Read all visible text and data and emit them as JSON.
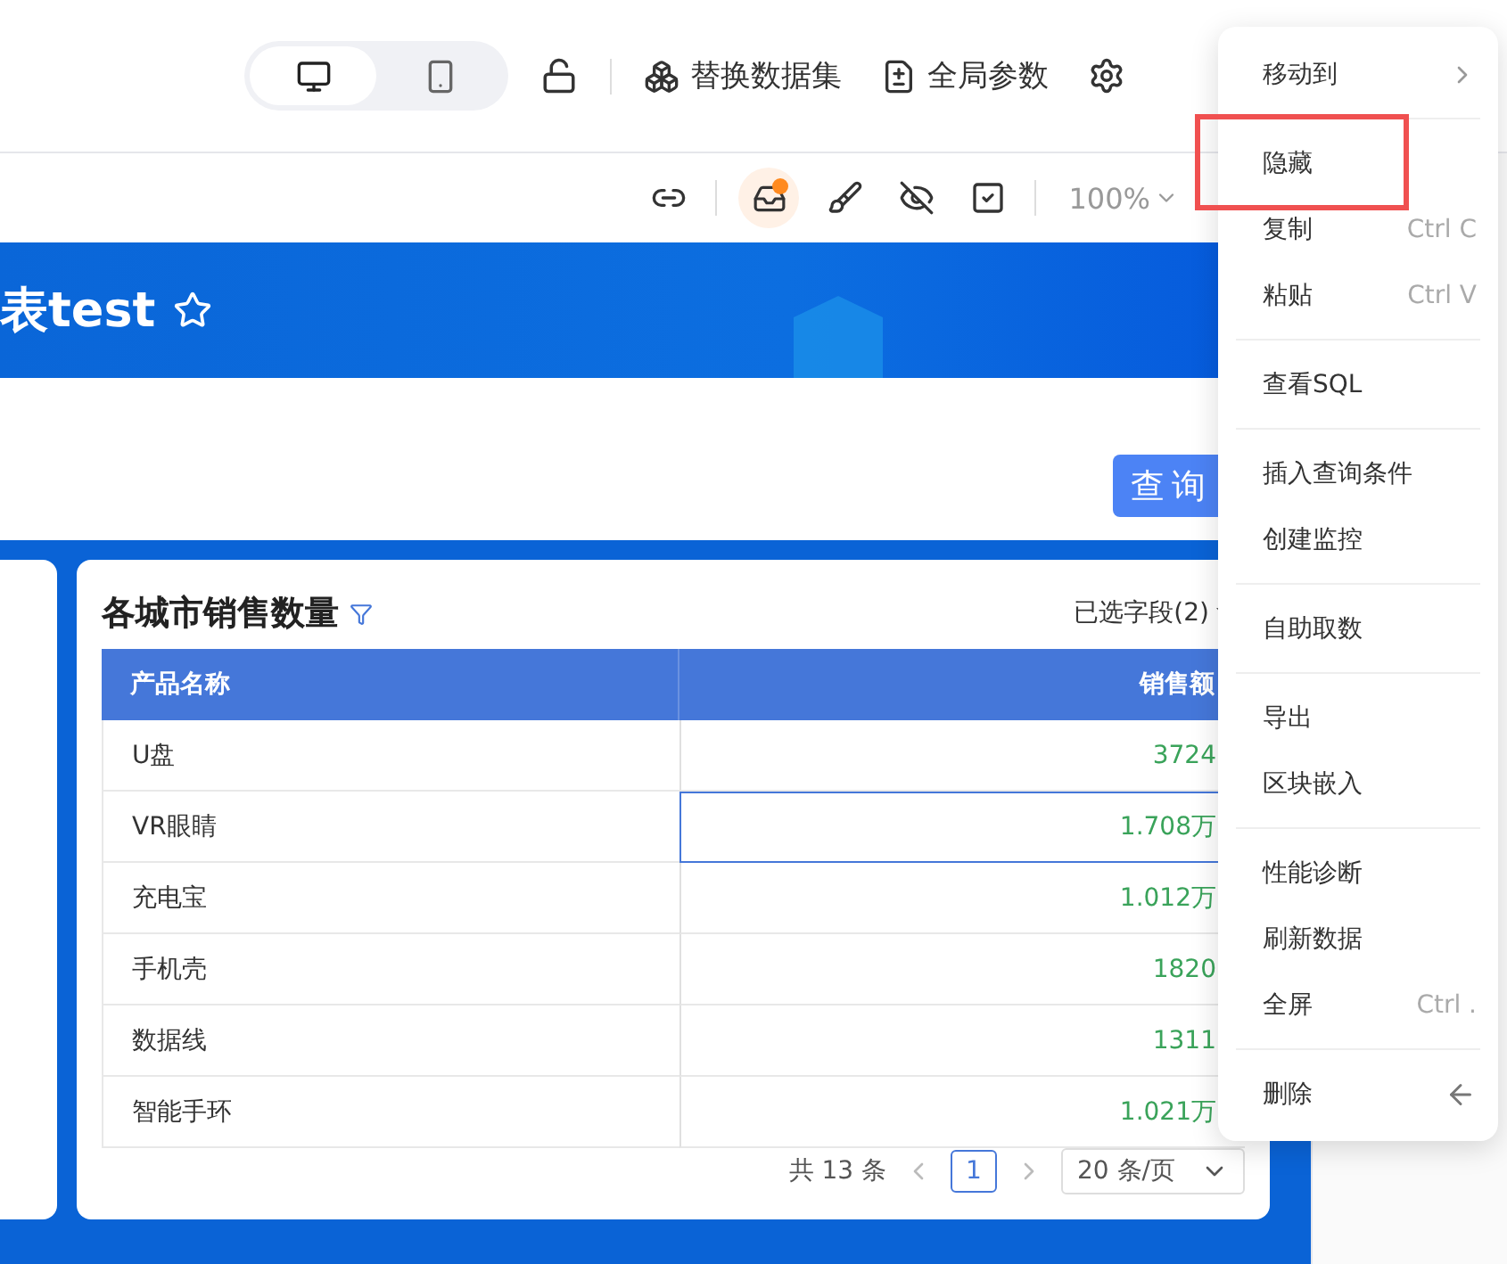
{
  "view_toggle": [
    {
      "kind": "desktop",
      "selected": true
    },
    {
      "kind": "mobile",
      "selected": false
    }
  ],
  "header_actions": [
    {
      "kind": "dataset",
      "label": "替换数据集"
    },
    {
      "kind": "params",
      "label": "全局参数"
    }
  ],
  "toolbar": {
    "notification": true,
    "zoom": "100%"
  },
  "banner": {
    "title": "表test"
  },
  "filter": {
    "query_button": "查询"
  },
  "card": {
    "title": "各城市销售数量",
    "fields": "已选字段(2)",
    "columns": [
      "产品名称",
      "销售额"
    ],
    "rows": [
      {
        "name": "U盘",
        "value": "3724",
        "selected": false
      },
      {
        "name": "VR眼睛",
        "value": "1.708万",
        "selected": true
      },
      {
        "name": "充电宝",
        "value": "1.012万",
        "selected": false
      },
      {
        "name": "手机壳",
        "value": "1820",
        "selected": false
      },
      {
        "name": "数据线",
        "value": "1311",
        "selected": false
      },
      {
        "name": "智能手环",
        "value": "1.021万",
        "selected": false
      }
    ],
    "pagination": {
      "total": "共 13 条",
      "page": "1",
      "page_size": "20 条/页"
    }
  },
  "context_menu": [
    [
      {
        "label": "移动到",
        "kind": "submenu",
        "highlighted": false
      }
    ],
    [
      {
        "label": "隐藏",
        "highlighted": true
      },
      {
        "label": "复制",
        "shortcut": "Ctrl C",
        "highlighted": false
      },
      {
        "label": "粘贴",
        "shortcut": "Ctrl V",
        "highlighted": false
      }
    ],
    [
      {
        "label": "查看SQL",
        "highlighted": false
      }
    ],
    [
      {
        "label": "插入查询条件",
        "highlighted": false
      },
      {
        "label": "创建监控",
        "highlighted": false
      }
    ],
    [
      {
        "label": "自助取数",
        "highlighted": false
      }
    ],
    [
      {
        "label": "导出",
        "highlighted": false
      },
      {
        "label": "区块嵌入",
        "highlighted": false
      }
    ],
    [
      {
        "label": "性能诊断",
        "highlighted": false
      },
      {
        "label": "刷新数据",
        "highlighted": false
      },
      {
        "label": "全屏",
        "shortcut": "Ctrl .",
        "highlighted": false
      }
    ],
    [
      {
        "label": "删除",
        "kind": "arrow",
        "highlighted": false
      }
    ]
  ]
}
